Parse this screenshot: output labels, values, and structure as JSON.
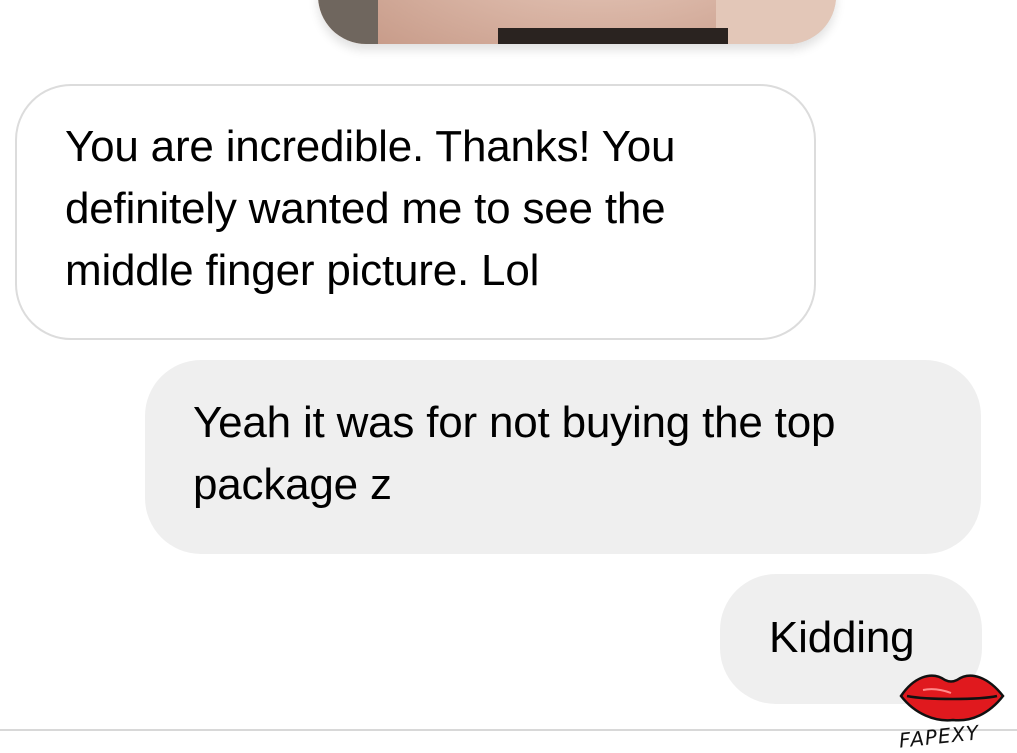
{
  "conversation": {
    "messages": [
      {
        "direction": "received",
        "text": "You are incredible. Thanks!  You\ndefinitely wanted me to see the\nmiddle finger picture. Lol"
      },
      {
        "direction": "sent",
        "text": "Yeah it was for not buying the top\npackage z"
      },
      {
        "direction": "sent",
        "text": "Kidding"
      }
    ]
  },
  "watermark": {
    "text": "FAPEXY",
    "icon": "lips-icon",
    "color": "#e0191e"
  },
  "colors": {
    "received_bubble_bg": "#ffffff",
    "received_bubble_border": "#dcdcdc",
    "sent_bubble_bg": "#efefef",
    "text": "#000000"
  }
}
